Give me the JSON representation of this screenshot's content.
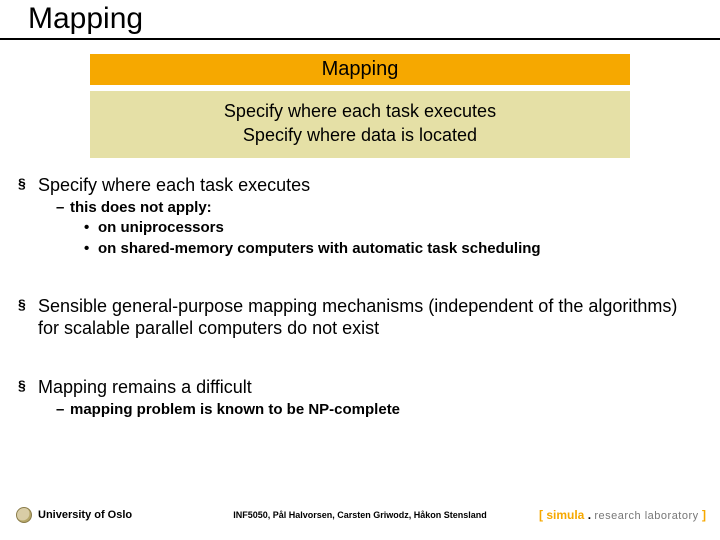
{
  "title": "Mapping",
  "orange_heading": "Mapping",
  "khaki_line1": "Specify where each task executes",
  "khaki_line2": "Specify where data is located",
  "bullets": {
    "b1": "Specify where each task executes",
    "b1_1": "this does not apply:",
    "b1_1a": "on uniprocessors",
    "b1_1b": "on shared-memory computers with automatic task scheduling",
    "b2": "Sensible general-purpose mapping mechanisms (independent of the algorithms) for scalable parallel computers do not exist",
    "b3": "Mapping remains a difficult",
    "b3_1": "mapping problem is known to be NP-complete"
  },
  "footer": {
    "uio": "University of Oslo",
    "center": "INF5050, Pål Halvorsen, Carsten Griwodz, Håkon Stensland",
    "brand_open": "[ ",
    "brand_name": "simula",
    "brand_dot": " . ",
    "brand_lab": "research laboratory",
    "brand_close": " ]"
  }
}
